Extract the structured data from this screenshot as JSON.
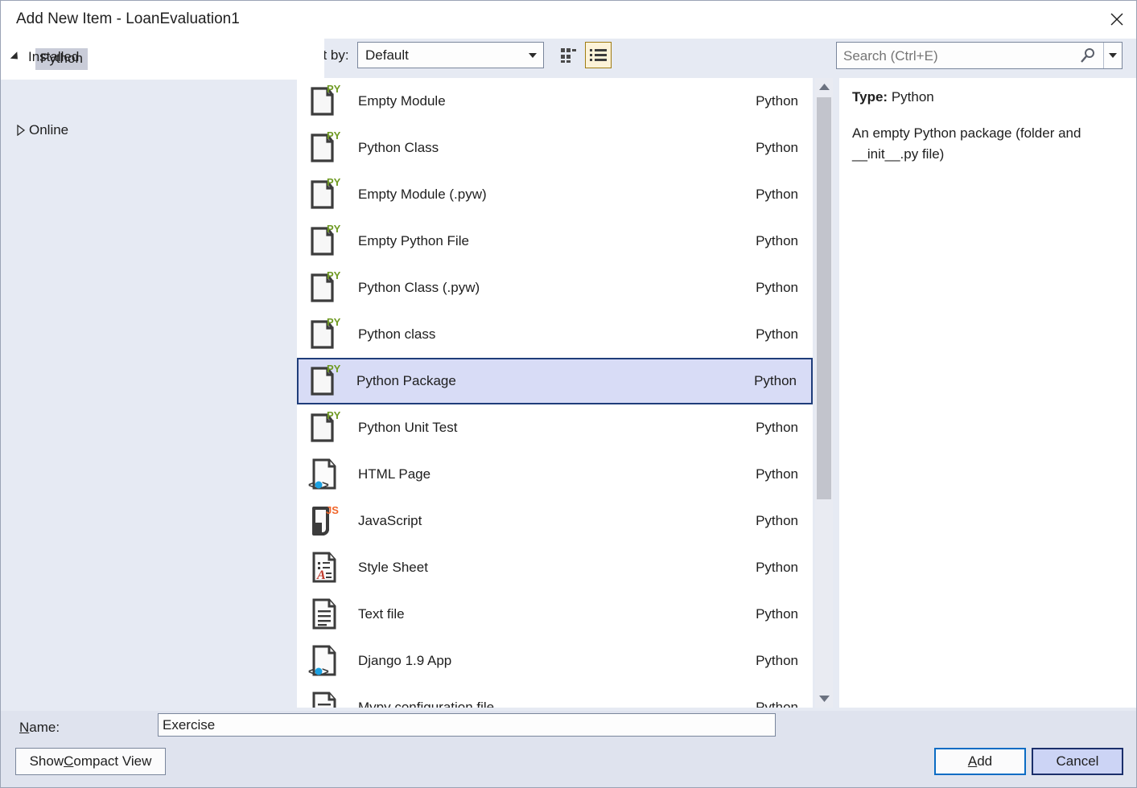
{
  "window": {
    "title": "Add New Item - LoanEvaluation1",
    "close_icon": "close-icon"
  },
  "toolbar": {
    "sort_label": "Sort by:",
    "sort_value": "Default",
    "grid_view_icon": "grid-view-icon",
    "list_view_icon": "list-view-icon",
    "list_view_selected": true
  },
  "search": {
    "placeholder": "Search (Ctrl+E)",
    "value": "",
    "icon": "search-icon",
    "dropdown_icon": "chevron-down-icon"
  },
  "sidebar": {
    "nodes": [
      {
        "label": "Installed",
        "expanded": true,
        "selected": false
      },
      {
        "label": "Python",
        "expanded": null,
        "selected": true
      },
      {
        "label": "Online",
        "expanded": false,
        "selected": false
      }
    ]
  },
  "list": {
    "items": [
      {
        "name": "Empty Module",
        "category": "Python",
        "icon": "python-file-icon",
        "selected": false
      },
      {
        "name": "Python Class",
        "category": "Python",
        "icon": "python-file-icon",
        "selected": false
      },
      {
        "name": "Empty Module (.pyw)",
        "category": "Python",
        "icon": "python-file-icon",
        "selected": false
      },
      {
        "name": "Empty Python File",
        "category": "Python",
        "icon": "python-file-icon",
        "selected": false
      },
      {
        "name": "Python Class (.pyw)",
        "category": "Python",
        "icon": "python-file-icon",
        "selected": false
      },
      {
        "name": "Python class",
        "category": "Python",
        "icon": "python-file-icon",
        "selected": false
      },
      {
        "name": "Python Package",
        "category": "Python",
        "icon": "python-file-icon",
        "selected": true
      },
      {
        "name": "Python Unit Test",
        "category": "Python",
        "icon": "python-file-icon",
        "selected": false
      },
      {
        "name": "HTML Page",
        "category": "Python",
        "icon": "html-file-icon",
        "selected": false
      },
      {
        "name": "JavaScript",
        "category": "Python",
        "icon": "javascript-file-icon",
        "selected": false
      },
      {
        "name": "Style Sheet",
        "category": "Python",
        "icon": "stylesheet-file-icon",
        "selected": false
      },
      {
        "name": "Text file",
        "category": "Python",
        "icon": "text-file-icon",
        "selected": false
      },
      {
        "name": "Django 1.9 App",
        "category": "Python",
        "icon": "html-file-icon",
        "selected": false
      },
      {
        "name": "Mypy configuration file",
        "category": "Python",
        "icon": "text-file-icon",
        "selected": false
      }
    ]
  },
  "scrollbar": {
    "up_icon": "scroll-up-arrow-icon",
    "down_icon": "scroll-down-arrow-icon"
  },
  "details": {
    "type_label": "Type:",
    "type_value": "Python",
    "description": "An empty Python package (folder and __init__.py file)"
  },
  "footer": {
    "name_label": "Name:",
    "name_value": "Exercise",
    "compact_view_button": "Show Compact View",
    "add_button": "Add",
    "cancel_button": "Cancel"
  },
  "colors": {
    "dialog_background": "#e6eaf3",
    "panel_white": "#ffffff",
    "selection_fill": "#d8dcf6",
    "selection_border": "#1f3d7a",
    "accent_gold": "#a07c12",
    "default_button_border": "#0a6cc4",
    "python_green": "#6f9a23",
    "javascript_orange": "#f06529"
  }
}
